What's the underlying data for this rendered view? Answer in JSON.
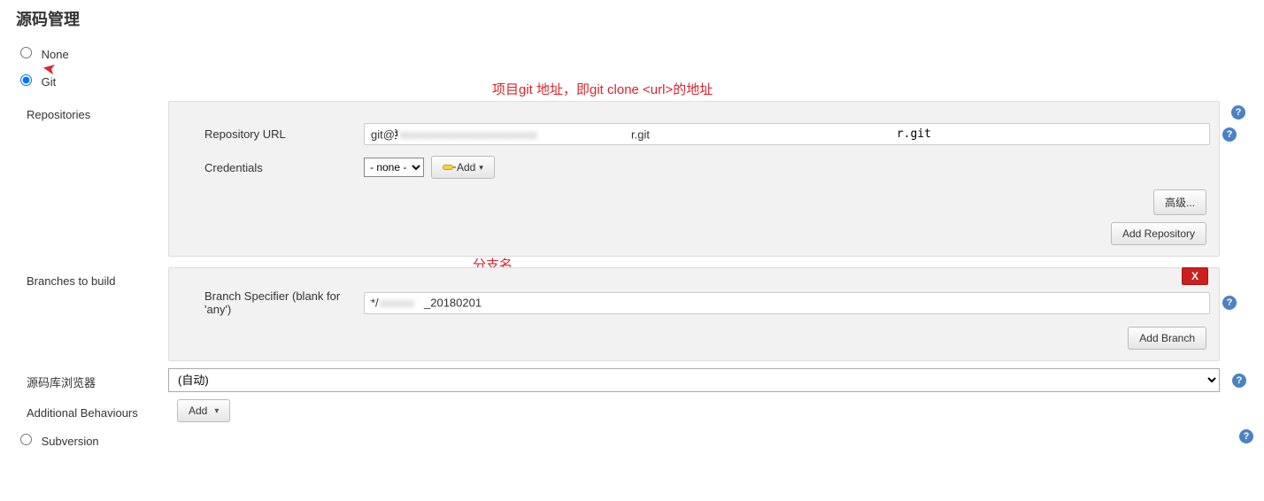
{
  "section_title": "源码管理",
  "scm": {
    "none_label": "None",
    "git_label": "Git",
    "subversion_label": "Subversion"
  },
  "annotations": {
    "repo_url_hint": "项目git 地址，即git clone <url>的地址",
    "branch_hint": "分支名"
  },
  "labels": {
    "repositories": "Repositories",
    "repository_url": "Repository URL",
    "credentials": "Credentials",
    "branches_to_build": "Branches to build",
    "branch_specifier": "Branch Specifier (blank for 'any')",
    "repo_browser": "源码库浏览器",
    "additional_behaviours": "Additional Behaviours"
  },
  "values": {
    "repository_url_prefix": "git@",
    "repository_url_suffix": "r.git",
    "credentials_selected": "- none -",
    "branch_prefix": "*/",
    "branch_suffix": "_20180201",
    "repo_browser_selected": "(自动)"
  },
  "buttons": {
    "add_credential": "Add",
    "advanced": "高级...",
    "add_repository": "Add Repository",
    "delete": "X",
    "add_branch": "Add Branch",
    "add_behaviour": "Add"
  }
}
